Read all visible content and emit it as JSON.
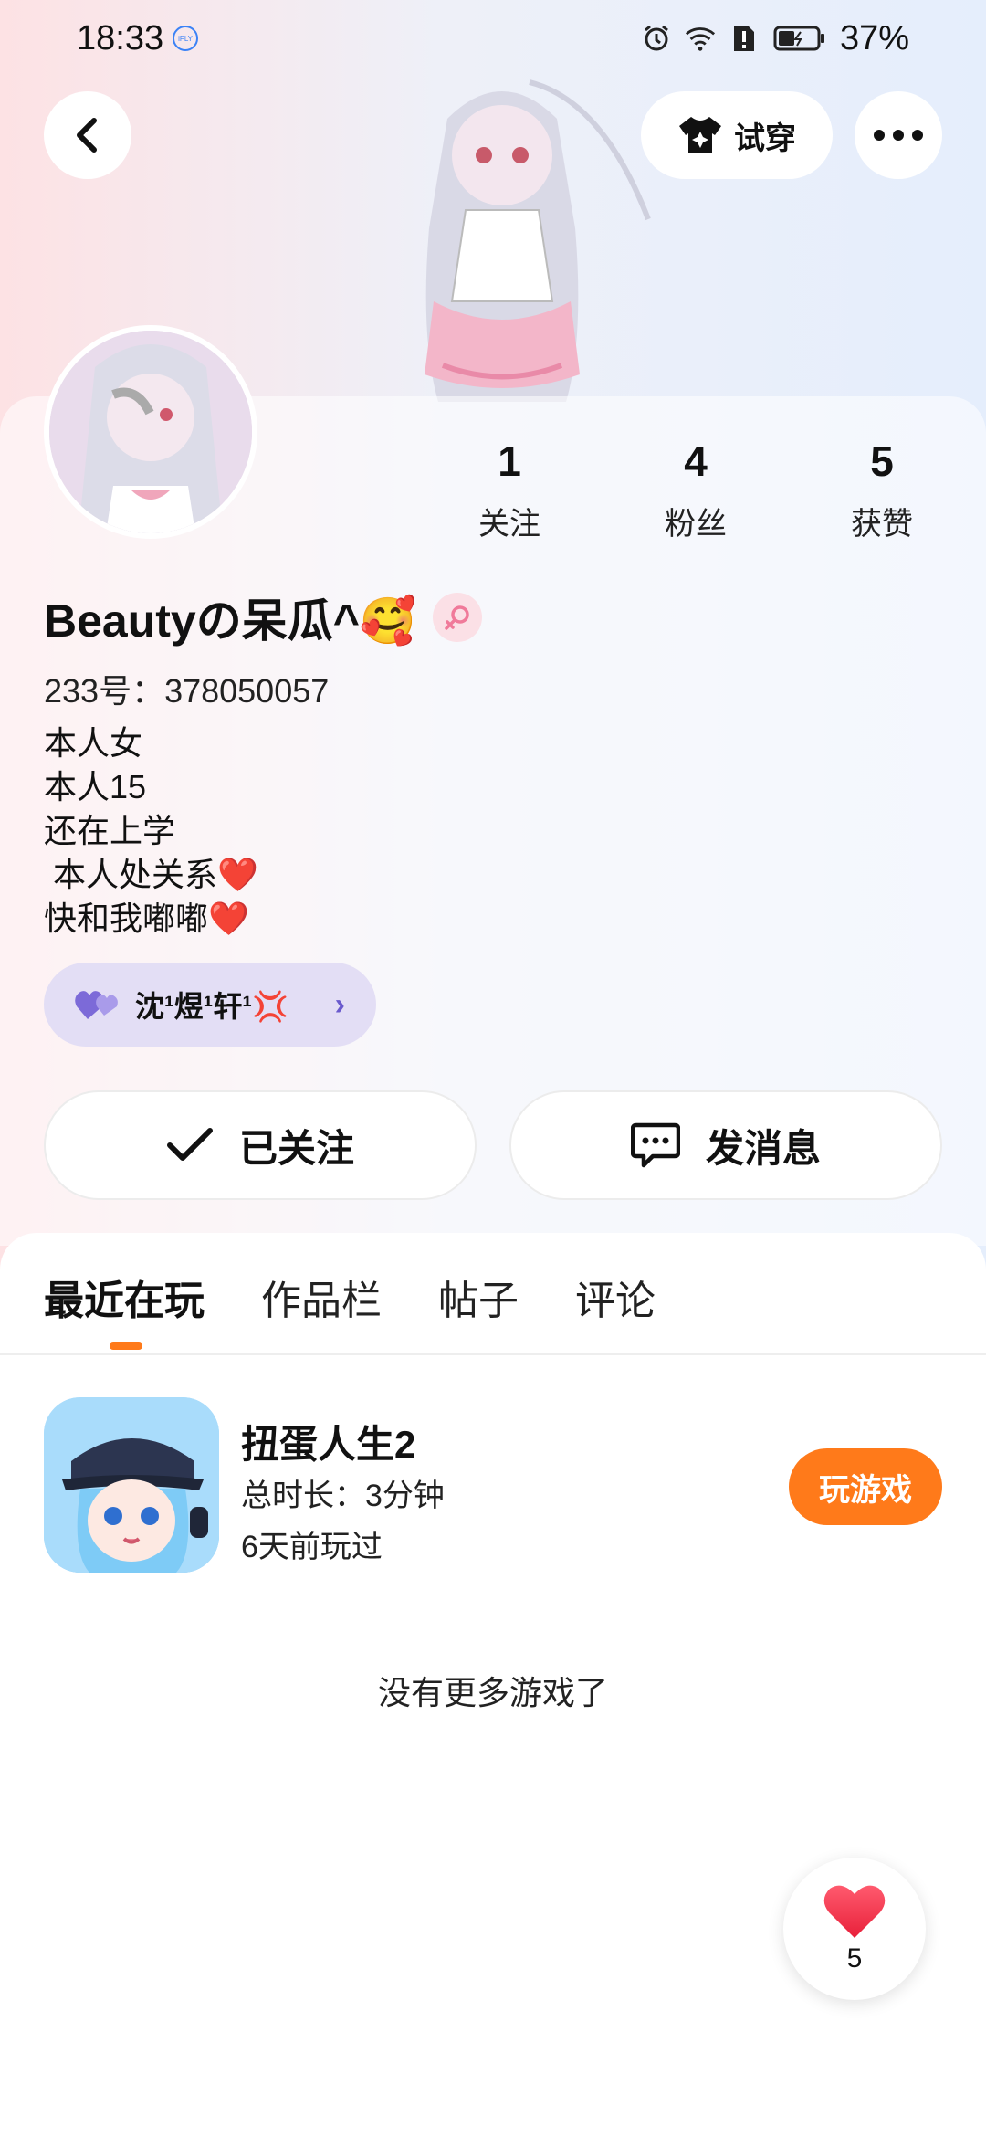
{
  "status_bar": {
    "time": "18:33",
    "ifly_badge": "iFLY",
    "battery_percent": "37%"
  },
  "header": {
    "try_on_label": "试穿"
  },
  "stats": [
    {
      "value": "1",
      "label": "关注"
    },
    {
      "value": "4",
      "label": "粉丝"
    },
    {
      "value": "5",
      "label": "获赞"
    }
  ],
  "profile": {
    "name": "Beautyの呆瓜^🥰",
    "gender": "female",
    "id_text": "233号：378050057",
    "bio": [
      "本人女",
      "本人15",
      "还在上学",
      " 本人处关系❤️",
      "快和我嘟嘟❤️"
    ],
    "guild_name": "沈¹煜¹轩¹💢"
  },
  "actions": {
    "followed_label": "已关注",
    "message_label": "发消息"
  },
  "tabs": [
    {
      "label": "最近在玩",
      "active": true
    },
    {
      "label": "作品栏",
      "active": false
    },
    {
      "label": "帖子",
      "active": false
    },
    {
      "label": "评论",
      "active": false
    }
  ],
  "recent_game": {
    "title": "扭蛋人生2",
    "duration": "总时长：3分钟",
    "last_played": "6天前玩过",
    "play_label": "玩游戏"
  },
  "no_more_text": "没有更多游戏了",
  "like_fab": {
    "count": "5"
  },
  "colors": {
    "accent_orange": "#ff7a1a",
    "guild_bg": "#e3def5",
    "gender_badge_bg": "#fbe0e6"
  }
}
